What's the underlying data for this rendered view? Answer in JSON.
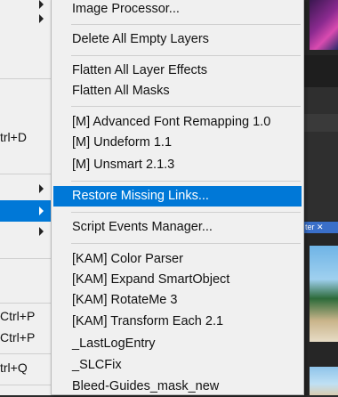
{
  "submenu": {
    "items": [
      {
        "label": "Image Processor...",
        "highlighted": false
      },
      {
        "label": "Delete All Empty Layers",
        "highlighted": false
      },
      {
        "label": "Flatten All Layer Effects",
        "highlighted": false
      },
      {
        "label": "Flatten All Masks",
        "highlighted": false
      },
      {
        "label": "[M] Advanced Font Remapping 1.0",
        "highlighted": false
      },
      {
        "label": "[M] Undeform 1.1",
        "highlighted": false
      },
      {
        "label": "[M] Unsmart 2.1.3",
        "highlighted": false
      },
      {
        "label": "Restore Missing Links...",
        "highlighted": true
      },
      {
        "label": "Script Events Manager...",
        "highlighted": false
      },
      {
        "label": "[KAM] Color Parser",
        "highlighted": false
      },
      {
        "label": "[KAM] Expand SmartObject",
        "highlighted": false
      },
      {
        "label": "[KAM] RotateMe 3",
        "highlighted": false
      },
      {
        "label": "[KAM] Transform Each 2.1",
        "highlighted": false
      },
      {
        "label": "_LastLogEntry",
        "highlighted": false
      },
      {
        "label": "_SLCFix",
        "highlighted": false
      },
      {
        "label": "Bleed-Guides_mask_new",
        "highlighted": false
      }
    ]
  },
  "parent_menu": {
    "shortcuts": [
      "trl+D",
      "Ctrl+P",
      "Ctrl+P",
      "trl+Q"
    ]
  },
  "background": {
    "tag_text": "ter ✕"
  },
  "colors": {
    "menu_bg": "#f0f0f0",
    "highlight": "#0078d7",
    "separator": "#cfcfcf",
    "app_bg": "#2b2b2b"
  }
}
